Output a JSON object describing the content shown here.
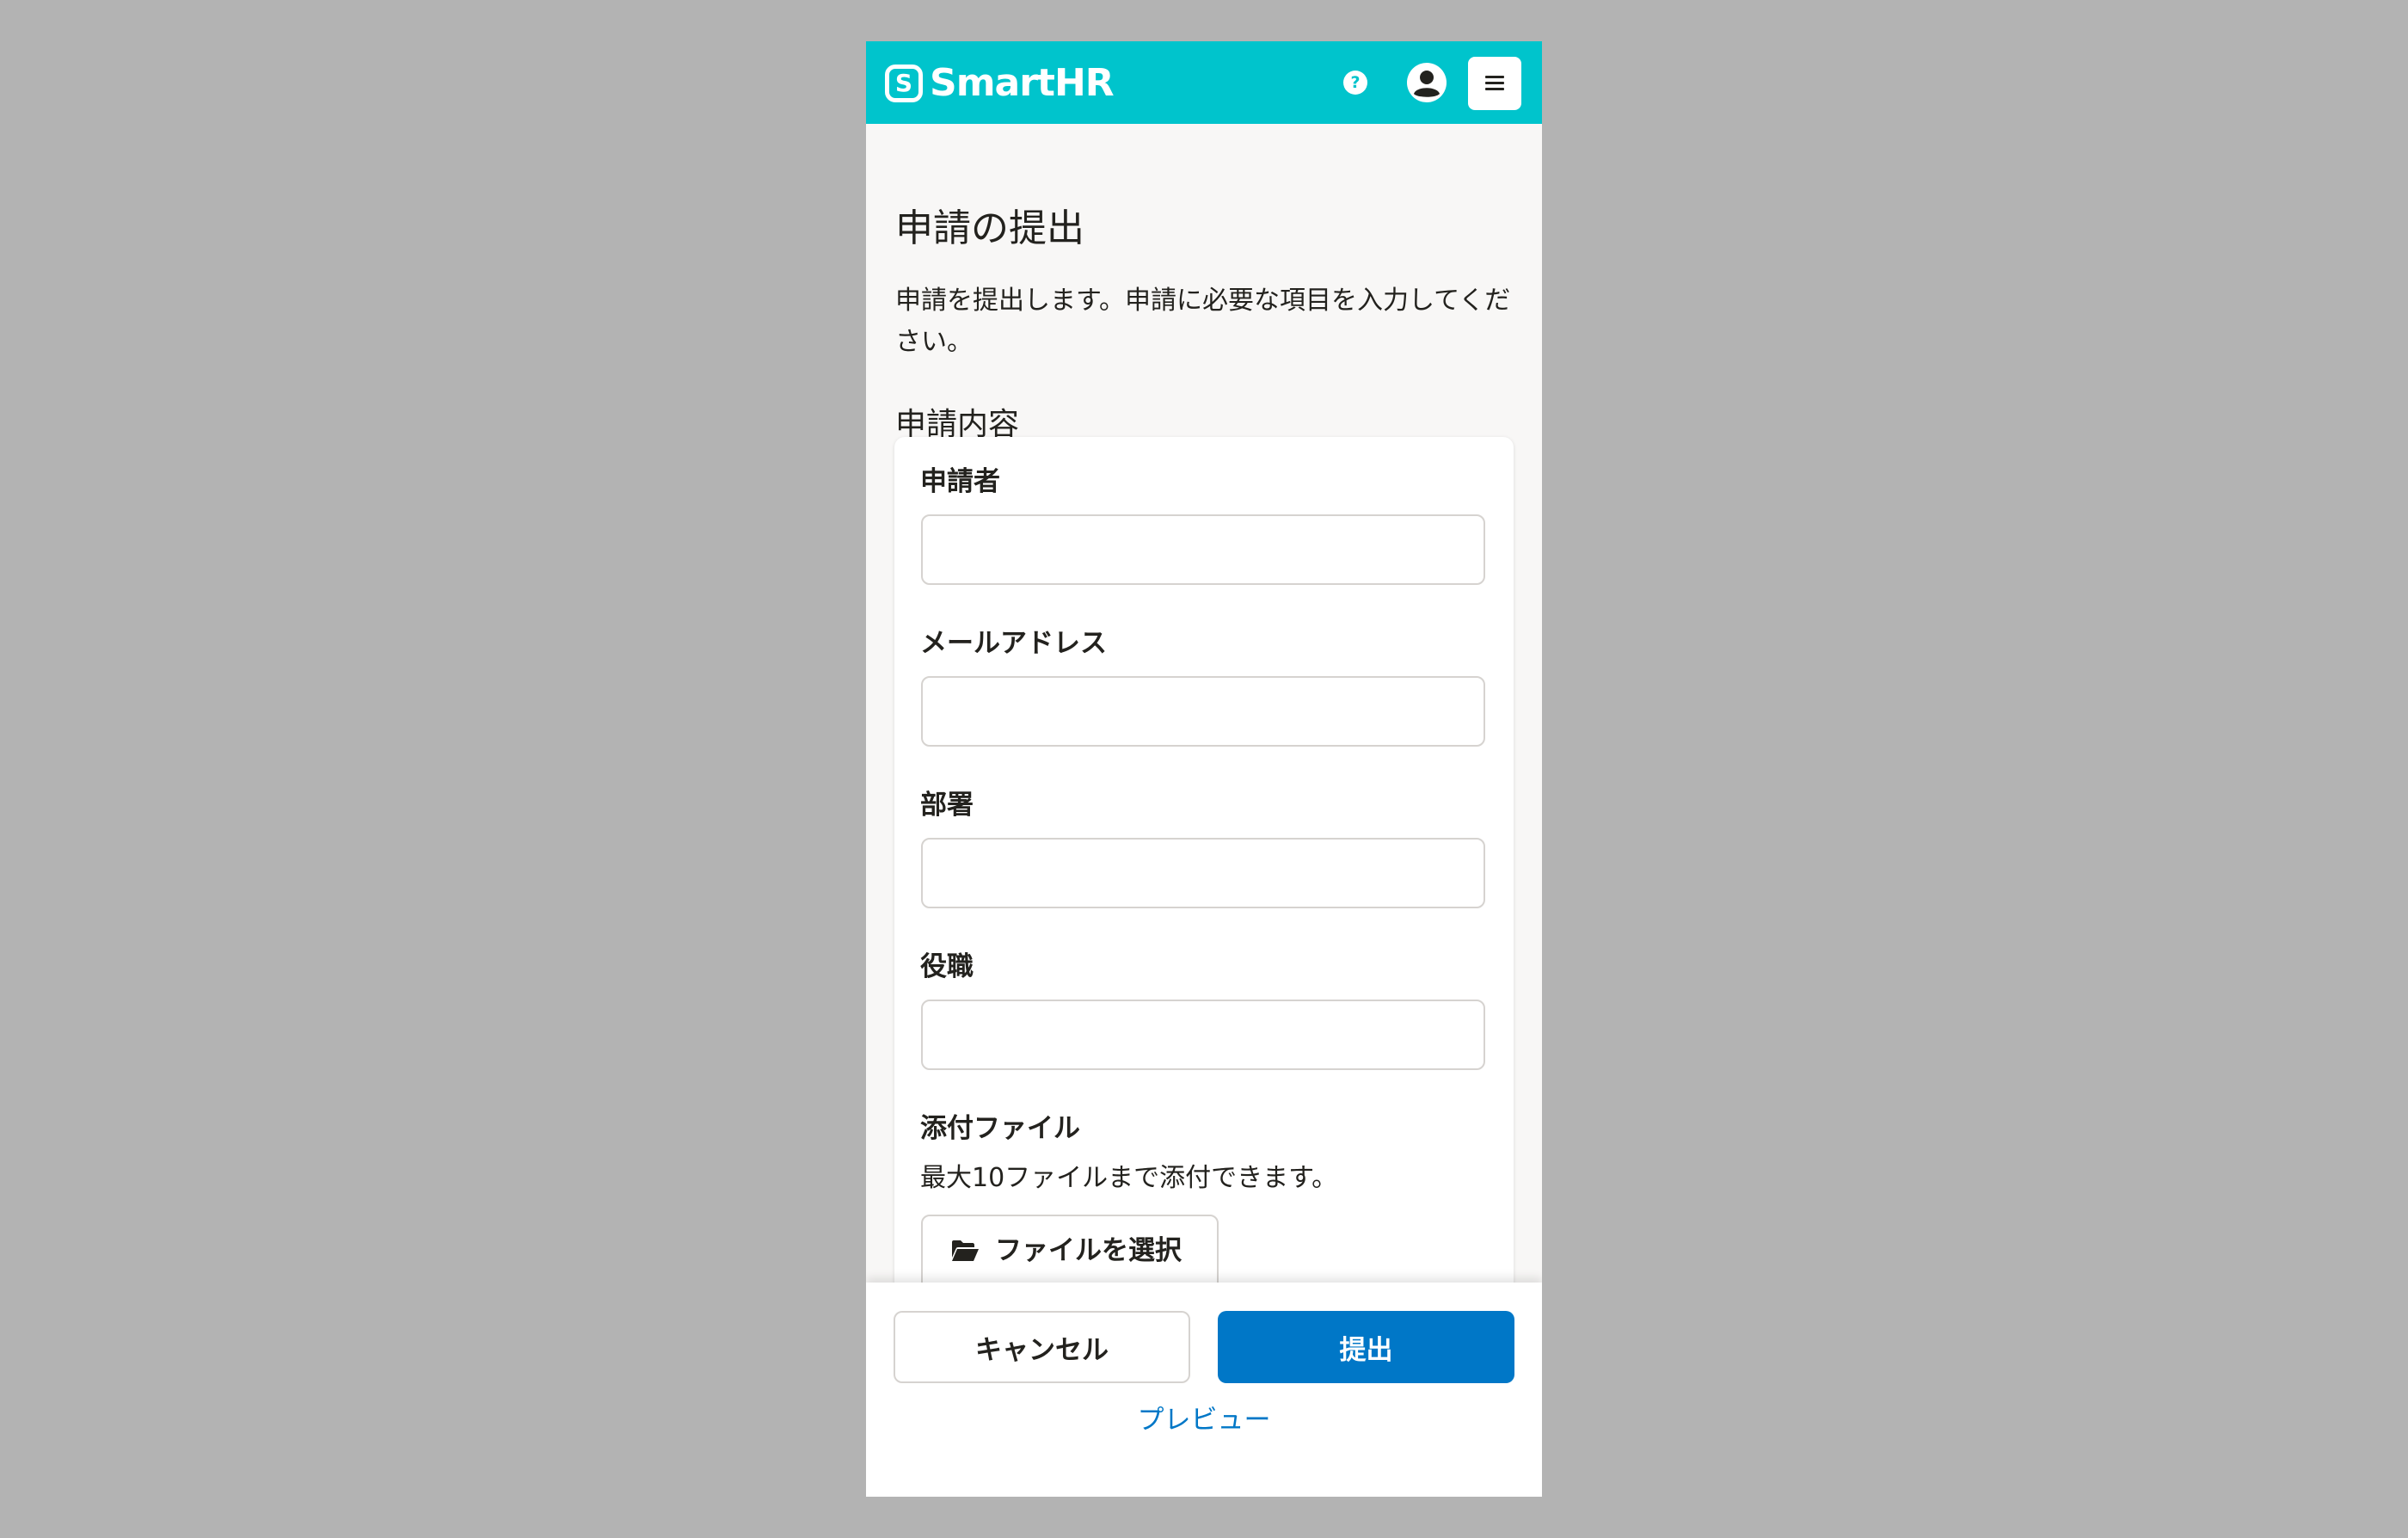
{
  "header": {
    "logo_mark": "S",
    "logo_text": "SmartHR",
    "help_glyph": "?",
    "icons": [
      "help-icon",
      "account-icon",
      "menu-icon"
    ],
    "colors": {
      "header_bg": "#00c4cc",
      "primary": "#0077c7"
    }
  },
  "page": {
    "title": "申請の提出",
    "description": "申請を提出します。申請に必要な項目を入力してください。",
    "section_title": "申請内容"
  },
  "form": {
    "fields": [
      {
        "label": "申請者",
        "value": ""
      },
      {
        "label": "メールアドレス",
        "value": ""
      },
      {
        "label": "部署",
        "value": ""
      },
      {
        "label": "役職",
        "value": ""
      }
    ],
    "attachment": {
      "label": "添付ファイル",
      "help": "最大10ファイルまで添付できます。",
      "button_label": "ファイルを選択",
      "icon": "folder-open-icon"
    }
  },
  "actions": {
    "cancel_label": "キャンセル",
    "submit_label": "提出",
    "preview_label": "プレビュー"
  }
}
